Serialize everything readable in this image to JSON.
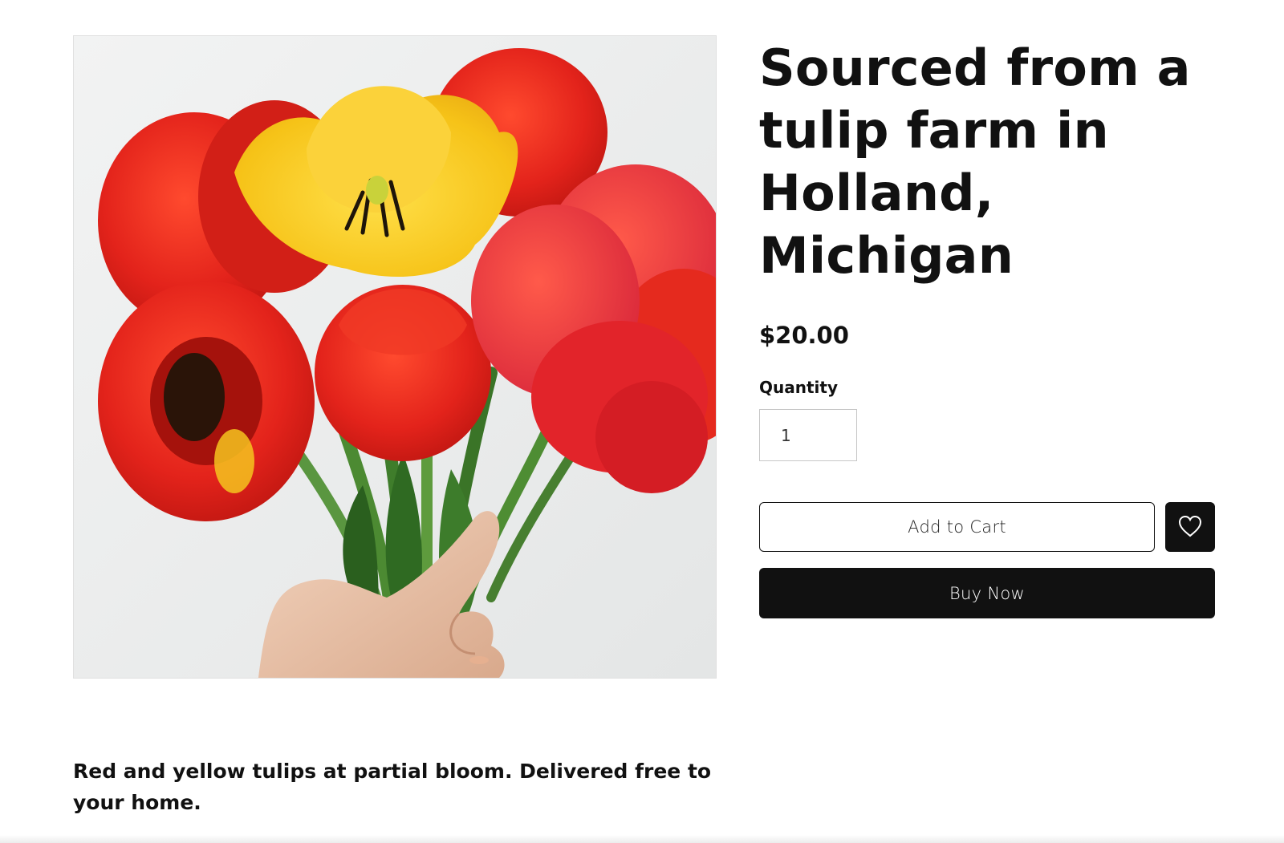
{
  "product": {
    "title": "Sourced from a tulip farm in Holland, Michigan",
    "price": "$20.00",
    "description": "Red and yellow tulips at partial bloom. Delivered free to your home.",
    "image_subject": "bouquet of red and yellow tulips held in a hand"
  },
  "quantity": {
    "label": "Quantity",
    "value": "1"
  },
  "actions": {
    "add_to_cart_label": "Add to Cart",
    "buy_now_label": "Buy Now",
    "wishlist_icon": "heart-icon"
  },
  "colors": {
    "text": "#111111",
    "button_dark": "#111111",
    "button_light": "#ffffff",
    "tulip_red": "#e0261f",
    "tulip_yellow": "#f7c51a",
    "stem_green": "#3c7a2e",
    "background": "#ffffff"
  }
}
